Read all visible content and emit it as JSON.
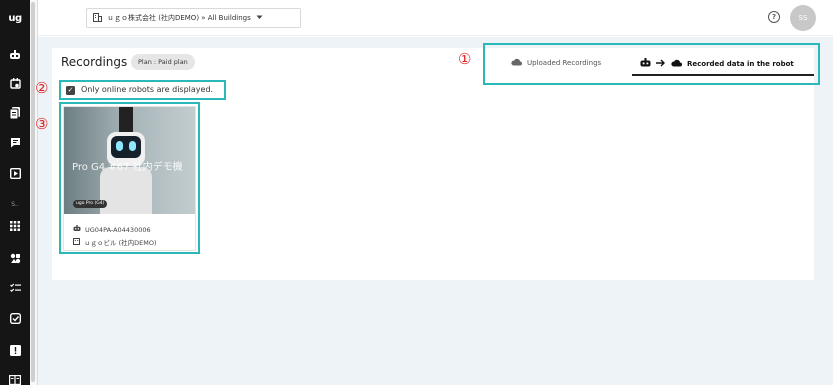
{
  "sidebar": {
    "logo": "ug",
    "section_label": "S..",
    "icons": [
      "robot-icon",
      "calendar-icon",
      "document-icon",
      "chat-icon",
      "play-icon",
      "grid-icon",
      "settings-icon",
      "checklist-icon",
      "check-square-icon",
      "alert-icon",
      "book-icon"
    ]
  },
  "topbar": {
    "building_selector": "ｕｇｏ株式会社 (社内DEMO) » All Buildings",
    "help_icon": "?",
    "avatar_initials": "SS"
  },
  "recordings": {
    "title": "Recordings",
    "plan_badge": "Plan : Paid plan",
    "tabs": [
      {
        "label": "Uploaded Recordings",
        "active": false
      },
      {
        "label": "Recorded data in the robot",
        "active": true
      }
    ],
    "filter": {
      "label": "Only online robots are displayed.",
      "checked": true
    },
    "card": {
      "name": "Pro G4 #67 社内デモ機",
      "model_tag": "ugo Pro (G4)",
      "robot_id": "UG04PA-A04430006",
      "building": "ｕｇｏビル (社内DEMO)"
    }
  },
  "annotations": {
    "n1": "①",
    "n2": "②",
    "n3": "③"
  },
  "colors": {
    "highlight": "#2bb8b8",
    "annotation": "#e02020",
    "sidebar_bg": "#151515",
    "content_bg": "#eef3f8"
  }
}
